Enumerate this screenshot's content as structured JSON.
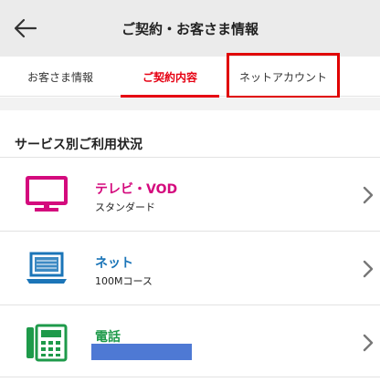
{
  "header": {
    "title": "ご契約・お客さま情報",
    "back_icon": "arrow-left-icon"
  },
  "tabs": [
    {
      "label": "お客さま情報",
      "active": false
    },
    {
      "label": "ご契約内容",
      "active": true
    },
    {
      "label": "ネットアカウント",
      "active": false,
      "highlighted": true
    }
  ],
  "section": {
    "title": "サービス別ご利用状況"
  },
  "services": [
    {
      "name": "テレビ・VOD",
      "sub": "スタンダード",
      "icon": "tv-icon",
      "color": "#d40a7d"
    },
    {
      "name": "ネット",
      "sub": "100Mコース",
      "icon": "laptop-icon",
      "color": "#1b75b8"
    },
    {
      "name": "電話",
      "sub": "",
      "icon": "phone-icon",
      "color": "#1e9a4a"
    }
  ],
  "colors": {
    "accent": "#e60012",
    "highlight": "#e00000",
    "redaction": "#4e79d4"
  }
}
